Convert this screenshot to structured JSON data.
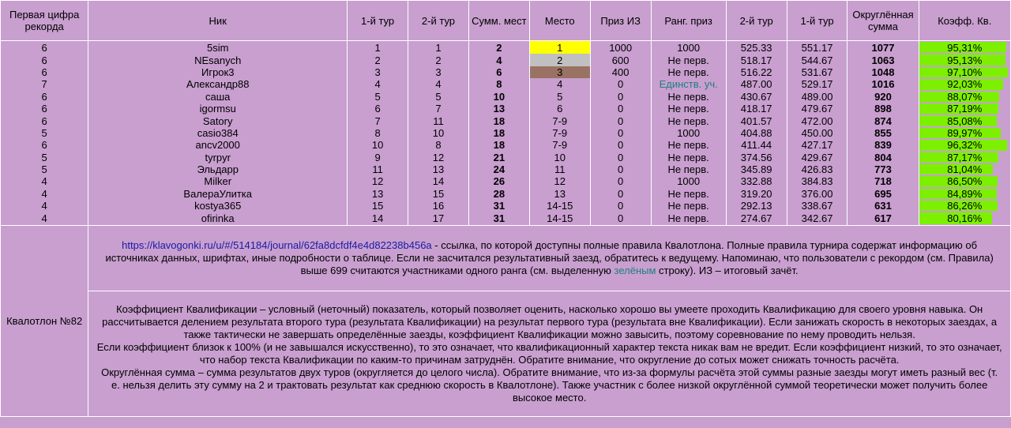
{
  "headers": {
    "first_digit": "Первая цифра рекорда",
    "nick": "Ник",
    "tour1": "1-й тур",
    "tour2": "2-й тур",
    "sum_places": "Сумм. мест",
    "place": "Место",
    "prize_iz": "Приз ИЗ",
    "rank_prize": "Ранг. приз",
    "speed2": "2-й тур",
    "speed1": "1-й тур",
    "rounded_sum": "Округлённая сумма",
    "coef": "Коэфф. Кв."
  },
  "rows": [
    {
      "digit": "6",
      "nick": "5sim",
      "t1": "1",
      "t2": "1",
      "sum": "2",
      "place": "1",
      "iz": "1000",
      "rank": "1000",
      "s2": "525.33",
      "s1": "551.17",
      "rsum": "1077",
      "coef": "95,31%",
      "coef_value": 95.31
    },
    {
      "digit": "6",
      "nick": "NEsanych",
      "t1": "2",
      "t2": "2",
      "sum": "4",
      "place": "2",
      "iz": "600",
      "rank": "Не перв.",
      "s2": "518.17",
      "s1": "544.67",
      "rsum": "1063",
      "coef": "95,13%",
      "coef_value": 95.13
    },
    {
      "digit": "6",
      "nick": "Игрок3",
      "t1": "3",
      "t2": "3",
      "sum": "6",
      "place": "3",
      "iz": "400",
      "rank": "Не перв.",
      "s2": "516.22",
      "s1": "531.67",
      "rsum": "1048",
      "coef": "97,10%",
      "coef_value": 97.1
    },
    {
      "digit": "7",
      "nick": "Александр88",
      "t1": "4",
      "t2": "4",
      "sum": "8",
      "place": "4",
      "iz": "0",
      "rank": "Единств. уч.",
      "s2": "487.00",
      "s1": "529.17",
      "rsum": "1016",
      "coef": "92,03%",
      "coef_value": 92.03
    },
    {
      "digit": "6",
      "nick": "саша",
      "t1": "5",
      "t2": "5",
      "sum": "10",
      "place": "5",
      "iz": "0",
      "rank": "Не перв.",
      "s2": "430.67",
      "s1": "489.00",
      "rsum": "920",
      "coef": "88,07%",
      "coef_value": 88.07
    },
    {
      "digit": "6",
      "nick": "igormsu",
      "t1": "6",
      "t2": "7",
      "sum": "13",
      "place": "6",
      "iz": "0",
      "rank": "Не перв.",
      "s2": "418.17",
      "s1": "479.67",
      "rsum": "898",
      "coef": "87,19%",
      "coef_value": 87.19
    },
    {
      "digit": "6",
      "nick": "Satory",
      "t1": "7",
      "t2": "11",
      "sum": "18",
      "place": "7-9",
      "iz": "0",
      "rank": "Не перв.",
      "s2": "401.57",
      "s1": "472.00",
      "rsum": "874",
      "coef": "85,08%",
      "coef_value": 85.08
    },
    {
      "digit": "5",
      "nick": "casio384",
      "t1": "8",
      "t2": "10",
      "sum": "18",
      "place": "7-9",
      "iz": "0",
      "rank": "1000",
      "s2": "404.88",
      "s1": "450.00",
      "rsum": "855",
      "coef": "89,97%",
      "coef_value": 89.97
    },
    {
      "digit": "6",
      "nick": "ancv2000",
      "t1": "10",
      "t2": "8",
      "sum": "18",
      "place": "7-9",
      "iz": "0",
      "rank": "Не перв.",
      "s2": "411.44",
      "s1": "427.17",
      "rsum": "839",
      "coef": "96,32%",
      "coef_value": 96.32
    },
    {
      "digit": "5",
      "nick": "tyrpyr",
      "t1": "9",
      "t2": "12",
      "sum": "21",
      "place": "10",
      "iz": "0",
      "rank": "Не перв.",
      "s2": "374.56",
      "s1": "429.67",
      "rsum": "804",
      "coef": "87,17%",
      "coef_value": 87.17
    },
    {
      "digit": "5",
      "nick": "Эльдарр",
      "t1": "11",
      "t2": "13",
      "sum": "24",
      "place": "11",
      "iz": "0",
      "rank": "Не перв.",
      "s2": "345.89",
      "s1": "426.83",
      "rsum": "773",
      "coef": "81,04%",
      "coef_value": 81.04
    },
    {
      "digit": "4",
      "nick": "Milker",
      "t1": "12",
      "t2": "14",
      "sum": "26",
      "place": "12",
      "iz": "0",
      "rank": "1000",
      "s2": "332.88",
      "s1": "384.83",
      "rsum": "718",
      "coef": "86,50%",
      "coef_value": 86.5
    },
    {
      "digit": "4",
      "nick": "ВалераУлитка",
      "t1": "13",
      "t2": "15",
      "sum": "28",
      "place": "13",
      "iz": "0",
      "rank": "Не перв.",
      "s2": "319.20",
      "s1": "376.00",
      "rsum": "695",
      "coef": "84,89%",
      "coef_value": 84.89
    },
    {
      "digit": "4",
      "nick": "kostya365",
      "t1": "15",
      "t2": "16",
      "sum": "31",
      "place": "14-15",
      "iz": "0",
      "rank": "Не перв.",
      "s2": "292.13",
      "s1": "338.67",
      "rsum": "631",
      "coef": "86,26%",
      "coef_value": 86.26
    },
    {
      "digit": "4",
      "nick": "ofirinka",
      "t1": "14",
      "t2": "17",
      "sum": "31",
      "place": "14-15",
      "iz": "0",
      "rank": "Не перв.",
      "s2": "274.67",
      "s1": "342.67",
      "rsum": "617",
      "coef": "80,16%",
      "coef_value": 80.16
    }
  ],
  "notes": {
    "label": "Квалотлон №82",
    "link_text": "https://klavogonki.ru/u/#/514184/journal/62fa8dcfdf4e4d82238b456a",
    "note1_a": " - ссылка, по которой доступны полные правила Квалотлона. Полные правила турнира содержат информацию об источниках данных, шрифтах, иные подробности о таблице. Если не засчитался результативный заезд, обратитесь к ведущему. Напоминаю, что пользователи с рекордом (см. Правила) выше 699 считаются участниками одного ранга (см. выделенную ",
    "note1_green": "зелёным",
    "note1_b": " строку). ИЗ – итоговый зачёт.",
    "note2_p1": "Коэффициент Квалификации – условный (неточный) показатель, который позволяет оценить, насколько хорошо вы умеете проходить Квалификацию для своего уровня навыка. Он рассчитывается делением результата второго тура (результата Квалификации) на результат первого тура (результата вне Квалификации). Если занижать скорость в некоторых заездах, а также тактически не завершать определённые заезды, коэффициент Квалификации можно завысить, поэтому соревнование по нему проводить нельзя.",
    "note2_p2": "Если коэффициент близок к 100% (и не завышался искусственно), то это означает, что квалификационный характер текста никак вам не вредит. Если коэффициент низкий, то это означает, что набор текста Квалификации по каким-то причинам затруднён. Обратите внимание, что округление до сотых может снижать точность расчёта.",
    "note2_p3": "Округлённая сумма – сумма результатов двух туров (округляется до целого числа). Обратите внимание, что из-за формулы расчёта этой суммы разные заезды могут иметь разный вес (т. е. нельзя делить эту сумму на 2 и трактовать результат как среднюю скорость в Квалотлоне). Также участник с более низкой округлённой суммой теоретически может получить более высокое место."
  },
  "colors": {
    "background": "#c89fcf",
    "gold": "#ffff00",
    "silver": "#c0c0c0",
    "bronze": "#9a7263",
    "coef_bar": "#7cf000",
    "highlight_text": "#1f7f7f"
  }
}
